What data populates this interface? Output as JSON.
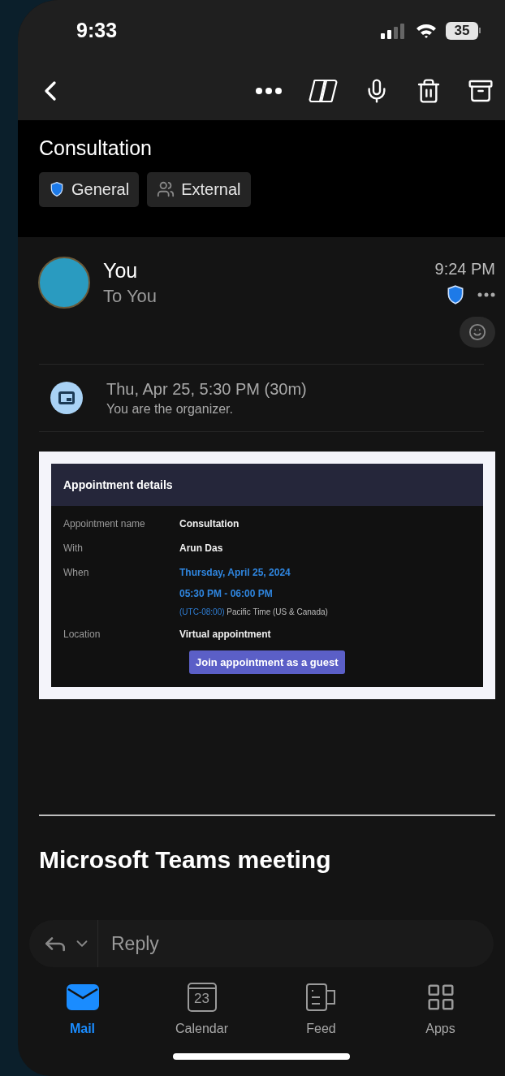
{
  "status_bar": {
    "time": "9:33",
    "battery": "35"
  },
  "subject": {
    "title": "Consultation",
    "tags": [
      {
        "label": "General",
        "kind": "shield"
      },
      {
        "label": "External",
        "kind": "external"
      }
    ]
  },
  "message": {
    "sender": "You",
    "recipient": "To You",
    "time": "9:24 PM"
  },
  "event": {
    "when": "Thu, Apr 25, 5:30 PM (30m)",
    "note": "You are the organizer."
  },
  "appointment_card": {
    "title": "Appointment details",
    "rows": [
      {
        "label": "Appointment name",
        "lines": [
          {
            "text": "Consultation",
            "kind": "bold"
          }
        ]
      },
      {
        "label": "With",
        "lines": [
          {
            "text": "Arun Das",
            "kind": "bold"
          }
        ]
      },
      {
        "label": "When",
        "lines": [
          {
            "text": "Thursday, April 25, 2024",
            "kind": "link"
          },
          {
            "text": "05:30 PM - 06:00 PM",
            "kind": "link"
          },
          {
            "text": "(UTC-08:00)",
            "kind": "zone",
            "extra": "Pacific Time (US & Canada)"
          }
        ]
      },
      {
        "label": "Location",
        "lines": [
          {
            "text": "Virtual appointment",
            "kind": "bold"
          }
        ]
      }
    ],
    "button": "Join appointment as a guest"
  },
  "teams_heading": "Microsoft Teams meeting",
  "reply": {
    "placeholder": "Reply"
  },
  "tabs": [
    {
      "label": "Mail",
      "kind": "mail",
      "selected": true
    },
    {
      "label": "Calendar",
      "kind": "calendar",
      "day": "23",
      "selected": false
    },
    {
      "label": "Feed",
      "kind": "feed",
      "selected": false
    },
    {
      "label": "Apps",
      "kind": "apps",
      "selected": false
    }
  ]
}
